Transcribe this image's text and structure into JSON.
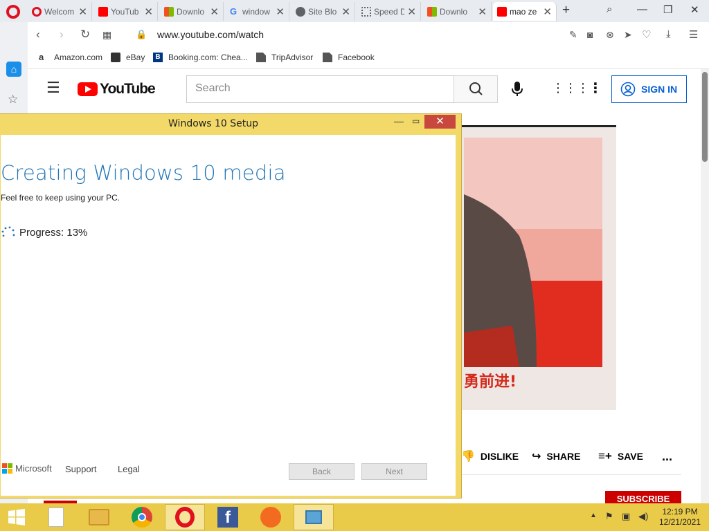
{
  "browser": {
    "tabs": [
      {
        "label": "Welcom",
        "icon": "opera-icon",
        "color": "#e0101f"
      },
      {
        "label": "YouTub",
        "icon": "youtube-icon",
        "color": "#ff0000"
      },
      {
        "label": "Downlo",
        "icon": "microsoft-icon",
        "color": "#f25022"
      },
      {
        "label": "window",
        "icon": "google-icon",
        "color": "#4285f4"
      },
      {
        "label": "Site Blo",
        "icon": "globe-icon",
        "color": "#5f6368"
      },
      {
        "label": "Speed D",
        "icon": "grid-icon",
        "color": "#5f6368"
      },
      {
        "label": "Downlo",
        "icon": "microsoft-icon",
        "color": "#f25022"
      },
      {
        "label": "mao ze",
        "icon": "youtube-icon",
        "color": "#ff0000"
      }
    ],
    "url": "www.youtube.com/watch",
    "bookmarks": [
      {
        "label": "Amazon.com",
        "icon": "amazon-icon"
      },
      {
        "label": "eBay",
        "icon": "ebay-icon"
      },
      {
        "label": "Booking.com: Chea...",
        "icon": "booking-icon"
      },
      {
        "label": "TripAdvisor",
        "icon": "page-icon"
      },
      {
        "label": "Facebook",
        "icon": "page-icon"
      }
    ]
  },
  "youtube": {
    "wordmark": "YouTube",
    "search_placeholder": "Search",
    "sign_in": "SIGN IN",
    "poster_caption": "勇前进!",
    "actions": {
      "dislike": "DISLIKE",
      "share": "SHARE",
      "save": "SAVE",
      "more": "..."
    },
    "subscribe": "SUBSCRIBE"
  },
  "setup": {
    "title": "Windows 10 Setup",
    "heading": "Creating Windows 10 media",
    "subtitle": "Feel free to keep using your PC.",
    "progress": "Progress: 13%",
    "progress_value": 13,
    "brand": "Microsoft",
    "support": "Support",
    "legal": "Legal",
    "back": "Back",
    "next": "Next"
  },
  "taskbar": {
    "time": "12:19 PM",
    "date": "12/21/2021",
    "apps": [
      "start-icon",
      "file-icon",
      "file-explorer-icon",
      "chrome-icon",
      "opera-icon",
      "facebook-icon",
      "avast-icon",
      "media-creation-tool-icon"
    ]
  },
  "colors": {
    "accent": "#1f75b8",
    "youtube_red": "#ff0000",
    "taskbar": "#e9cb49",
    "signin_blue": "#065fd4"
  }
}
